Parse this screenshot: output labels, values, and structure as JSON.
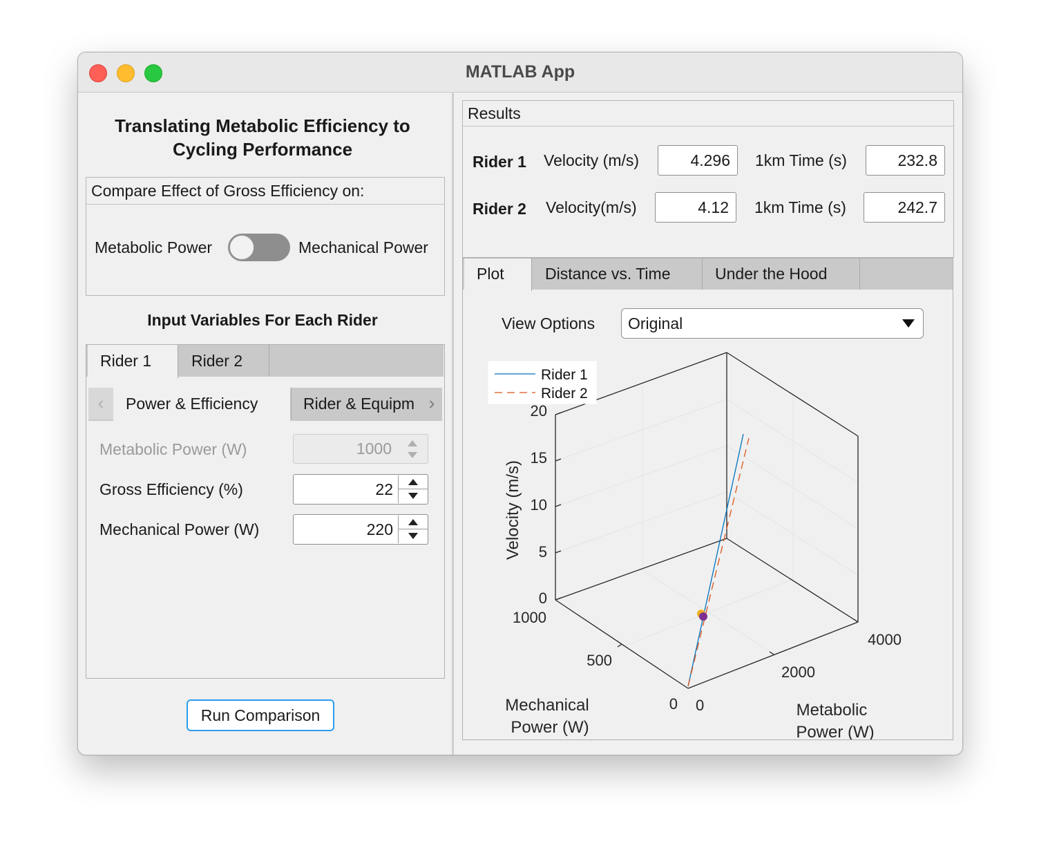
{
  "window": {
    "title": "MATLAB App"
  },
  "left": {
    "heading": "Translating Metabolic Efficiency to Cycling Performance",
    "compare_title": "Compare Effect of Gross Efficiency on:",
    "switch_left": "Metabolic Power",
    "switch_right": "Mechanical Power",
    "input_heading": "Input Variables For Each Rider",
    "rider_tabs": [
      "Rider 1",
      "Rider 2"
    ],
    "sub_tabs": [
      "Power & Efficiency",
      "Rider & Equipm"
    ],
    "fields": [
      {
        "label": "Metabolic Power (W)",
        "value": "1000"
      },
      {
        "label": "Gross Efficiency (%)",
        "value": "22"
      },
      {
        "label": "Mechanical Power (W)",
        "value": "220"
      }
    ],
    "run_button": "Run Comparison"
  },
  "results": {
    "title": "Results",
    "rows": [
      {
        "rider": "Rider 1",
        "vel_label": "Velocity (m/s)",
        "vel": "4.296",
        "time_label": "1km Time (s)",
        "time": "232.8"
      },
      {
        "rider": "Rider 2",
        "vel_label": "Velocity(m/s)",
        "vel": "4.12",
        "time_label": "1km Time (s)",
        "time": "242.7"
      }
    ]
  },
  "plot_tabs": [
    "Plot",
    "Distance vs. Time",
    "Under the Hood"
  ],
  "view_options": {
    "label": "View Options",
    "value": "Original"
  },
  "colors": {
    "rider1": "#0072BD",
    "rider2": "#D95319",
    "marker1": "#EDB120",
    "marker2": "#7E2F8E"
  },
  "chart_data": {
    "type": "line",
    "legend": [
      "Rider 1",
      "Rider 2"
    ],
    "legend_placement": "top-left",
    "grid": true,
    "axes": {
      "x": {
        "label": "Metabolic Power (W)",
        "ticks": [
          "0",
          "2000",
          "4000"
        ],
        "lim": [
          0,
          4000
        ]
      },
      "y": {
        "label": "Mechanical Power (W)",
        "ticks": [
          "0",
          "500",
          "1000"
        ],
        "lim": [
          0,
          1000
        ]
      },
      "z": {
        "label": "Velocity (m/s)",
        "ticks": [
          "0",
          "5",
          "10",
          "15",
          "20"
        ],
        "lim": [
          0,
          20
        ]
      }
    },
    "series": [
      {
        "name": "Rider 1",
        "style": "solid"
      },
      {
        "name": "Rider 2",
        "style": "dashed"
      }
    ],
    "markers": [
      {
        "series": "Rider 1",
        "x": 1000,
        "y": 220,
        "z": 4.296
      },
      {
        "series": "Rider 2",
        "x": 1000,
        "y": 220,
        "z": 4.12
      }
    ]
  }
}
